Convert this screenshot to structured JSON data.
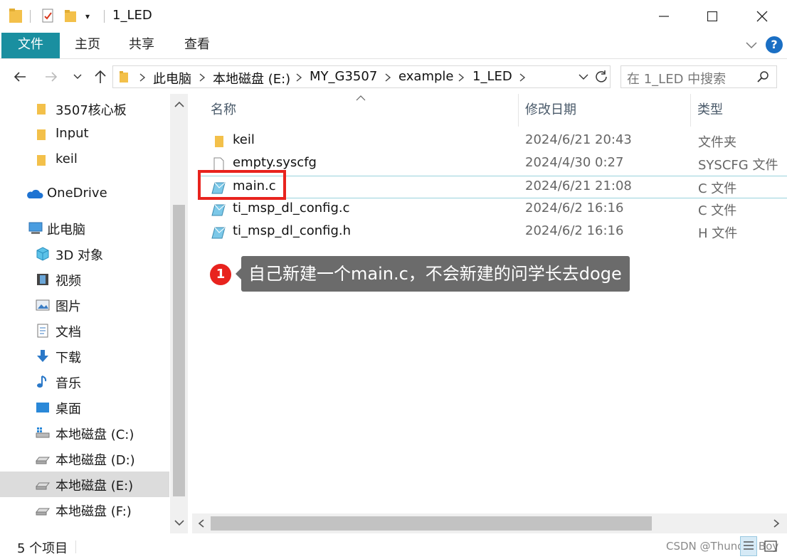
{
  "window": {
    "title": "1_LED"
  },
  "ribbon": {
    "tabs": [
      "文件",
      "主页",
      "共享",
      "查看"
    ],
    "help": "?"
  },
  "address": {
    "crumbs": [
      "此电脑",
      "本地磁盘 (E:)",
      "MY_G3507",
      "example",
      "1_LED"
    ],
    "search_placeholder": "在 1_LED 中搜索"
  },
  "nav": {
    "items": [
      {
        "label": "3507核心板",
        "icon": "folder-icon"
      },
      {
        "label": "Input",
        "icon": "folder-icon"
      },
      {
        "label": "keil",
        "icon": "folder-icon"
      },
      {
        "label": "OneDrive",
        "icon": "onedrive-cloud-icon"
      },
      {
        "label": "此电脑",
        "icon": "this-pc-icon"
      },
      {
        "label": "3D 对象",
        "icon": "3d-objects-icon"
      },
      {
        "label": "视频",
        "icon": "videos-icon"
      },
      {
        "label": "图片",
        "icon": "pictures-icon"
      },
      {
        "label": "文档",
        "icon": "documents-icon"
      },
      {
        "label": "下载",
        "icon": "downloads-icon"
      },
      {
        "label": "音乐",
        "icon": "music-icon"
      },
      {
        "label": "桌面",
        "icon": "desktop-icon"
      },
      {
        "label": "本地磁盘 (C:)",
        "icon": "system-drive-icon"
      },
      {
        "label": "本地磁盘 (D:)",
        "icon": "drive-icon"
      },
      {
        "label": "本地磁盘 (E:)",
        "icon": "drive-icon",
        "selected": true
      },
      {
        "label": "本地磁盘 (F:)",
        "icon": "drive-icon"
      }
    ]
  },
  "files": {
    "columns": [
      "名称",
      "修改日期",
      "类型"
    ],
    "rows": [
      {
        "name": "keil",
        "date": "2024/6/21 20:43",
        "type": "文件夹",
        "icon": "folder-icon"
      },
      {
        "name": "empty.syscfg",
        "date": "2024/4/30 0:27",
        "type": "SYSCFG 文件",
        "icon": "blank-file-icon"
      },
      {
        "name": "main.c",
        "date": "2024/6/21 21:08",
        "type": "C 文件",
        "icon": "c-file-icon",
        "focused": true
      },
      {
        "name": "ti_msp_dl_config.c",
        "date": "2024/6/2 16:16",
        "type": "C 文件",
        "icon": "c-file-icon"
      },
      {
        "name": "ti_msp_dl_config.h",
        "date": "2024/6/2 16:16",
        "type": "H 文件",
        "icon": "h-file-icon"
      }
    ]
  },
  "annotation": {
    "number": "1",
    "text": "自己新建一个main.c，不会新建的问学长去doge",
    "color": "#e8231e"
  },
  "status": {
    "count": "5 个项目",
    "watermark": "CSDN @Thunder Boy"
  },
  "colors": {
    "file_tab": "#1a8fa0",
    "selection": "#dcdcdc",
    "help": "#1a6fc4"
  }
}
